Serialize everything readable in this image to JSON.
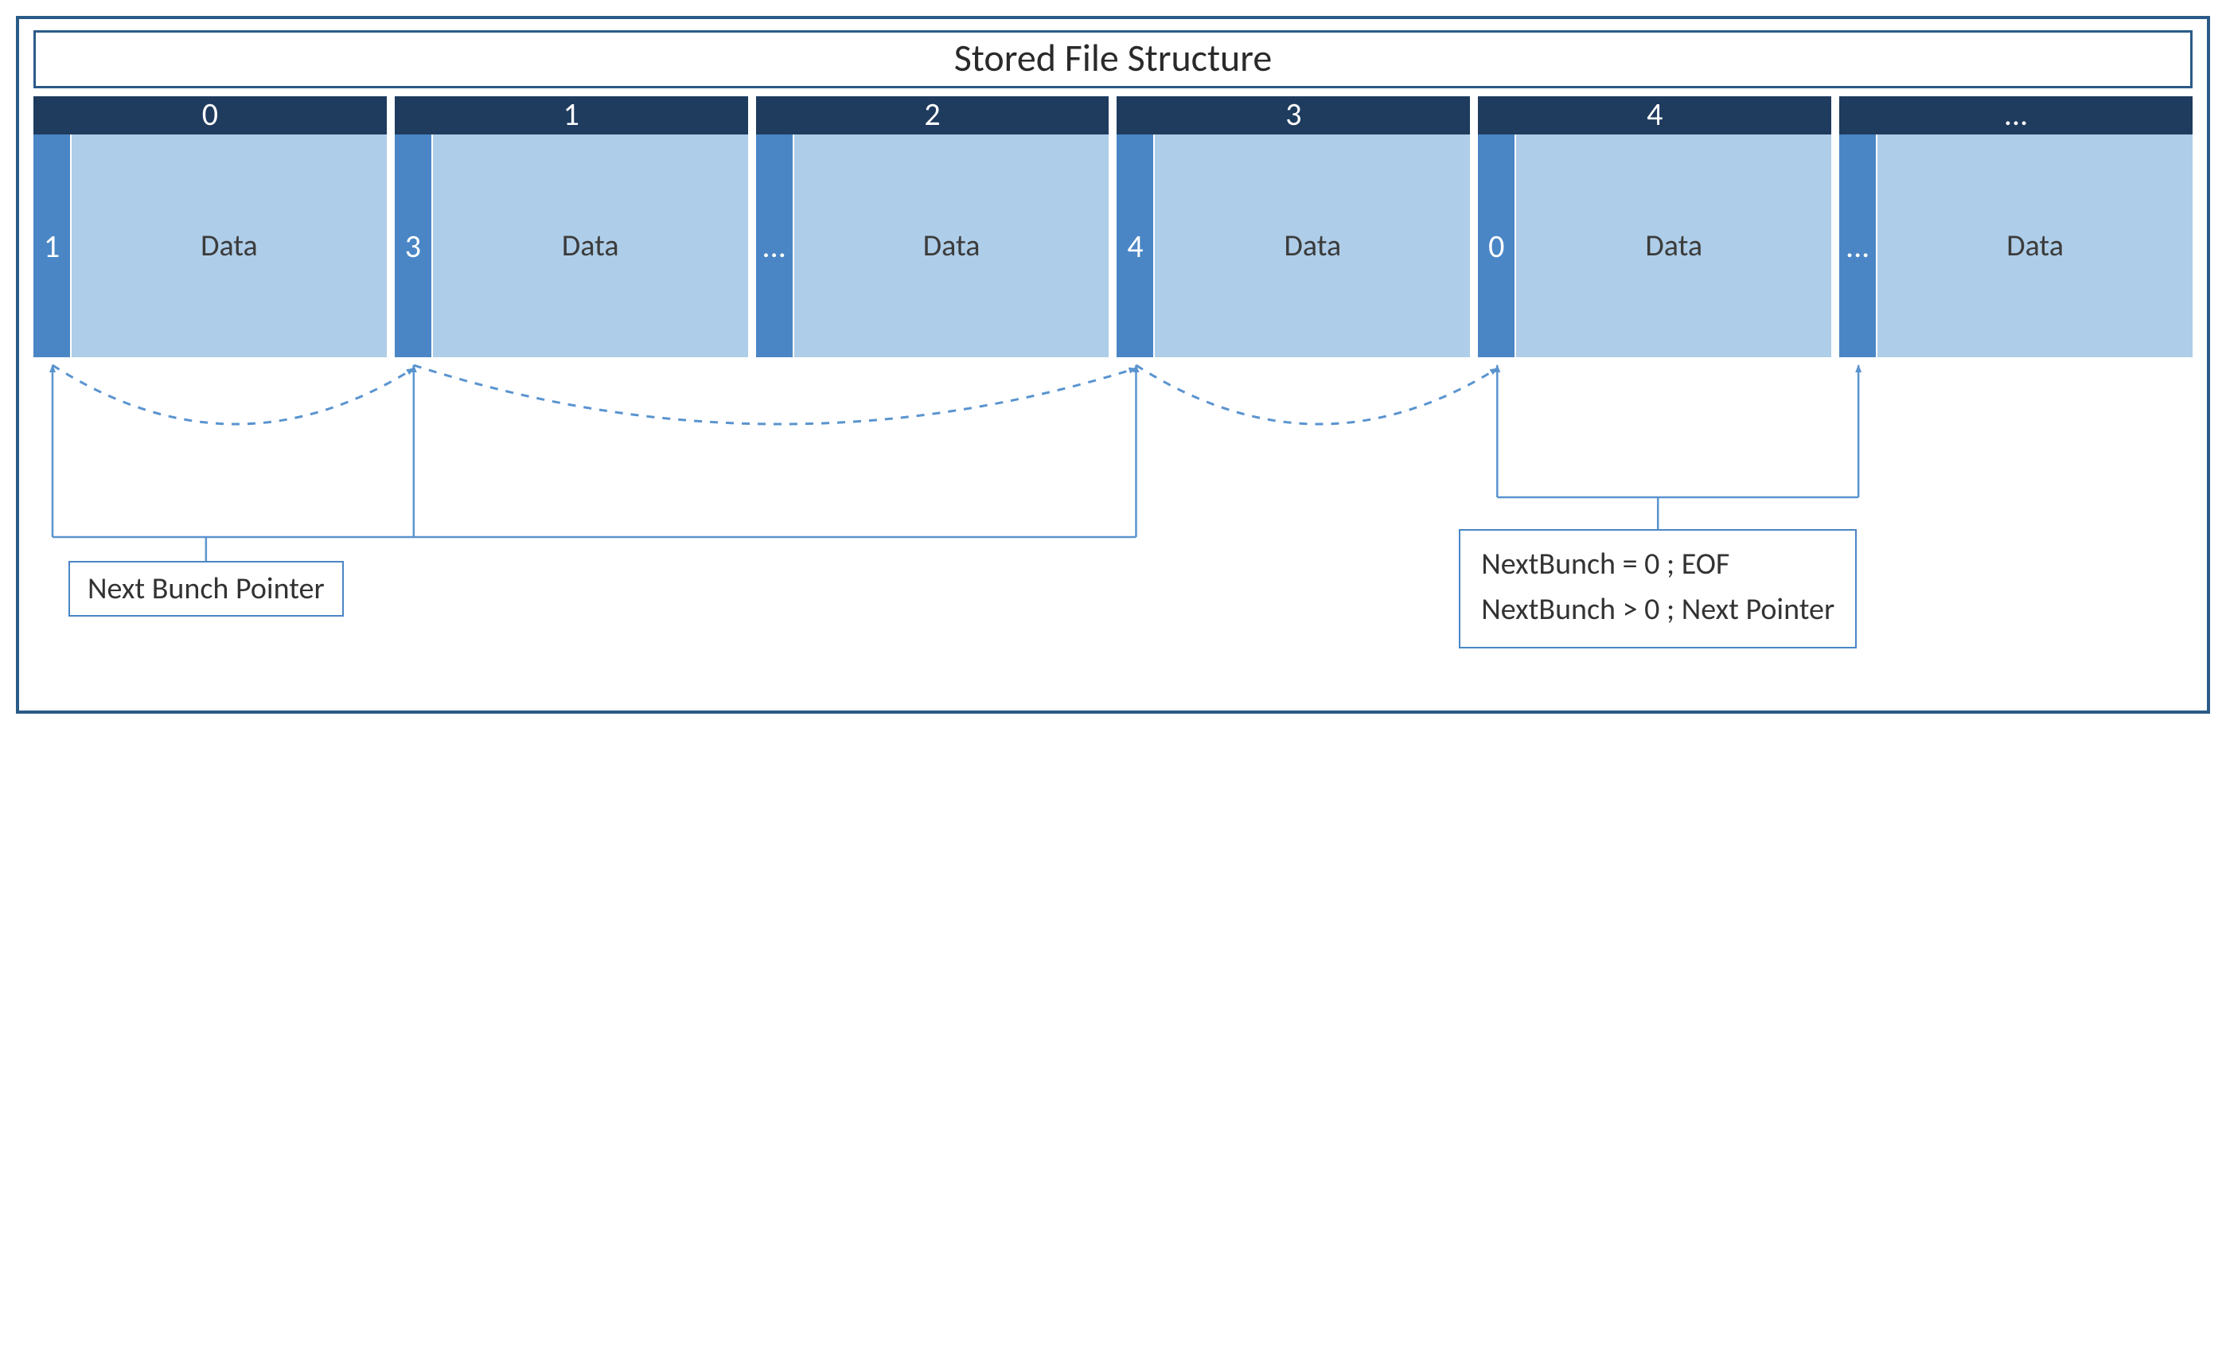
{
  "title": "Stored File Structure",
  "blocks": {
    "headers": [
      "0",
      "1",
      "2",
      "3",
      "4",
      "..."
    ],
    "pointers": [
      "1",
      "3",
      "...",
      "4",
      "0",
      "..."
    ],
    "data_label": "Data"
  },
  "labels": {
    "next_bunch_pointer": "Next Bunch Pointer",
    "legend_line1": "NextBunch = 0 ; EOF",
    "legend_line2": "NextBunch > 0 ; Next Pointer"
  },
  "colors": {
    "frame": "#2a5b88",
    "header_bg": "#1f3b5e",
    "ptr_bg": "#4a86c5",
    "data_bg": "#aecde8",
    "arrow": "#5a94cf"
  },
  "pointer_links": [
    {
      "from": 0,
      "to": 1
    },
    {
      "from": 1,
      "to": 3
    },
    {
      "from": 3,
      "to": 4
    }
  ]
}
